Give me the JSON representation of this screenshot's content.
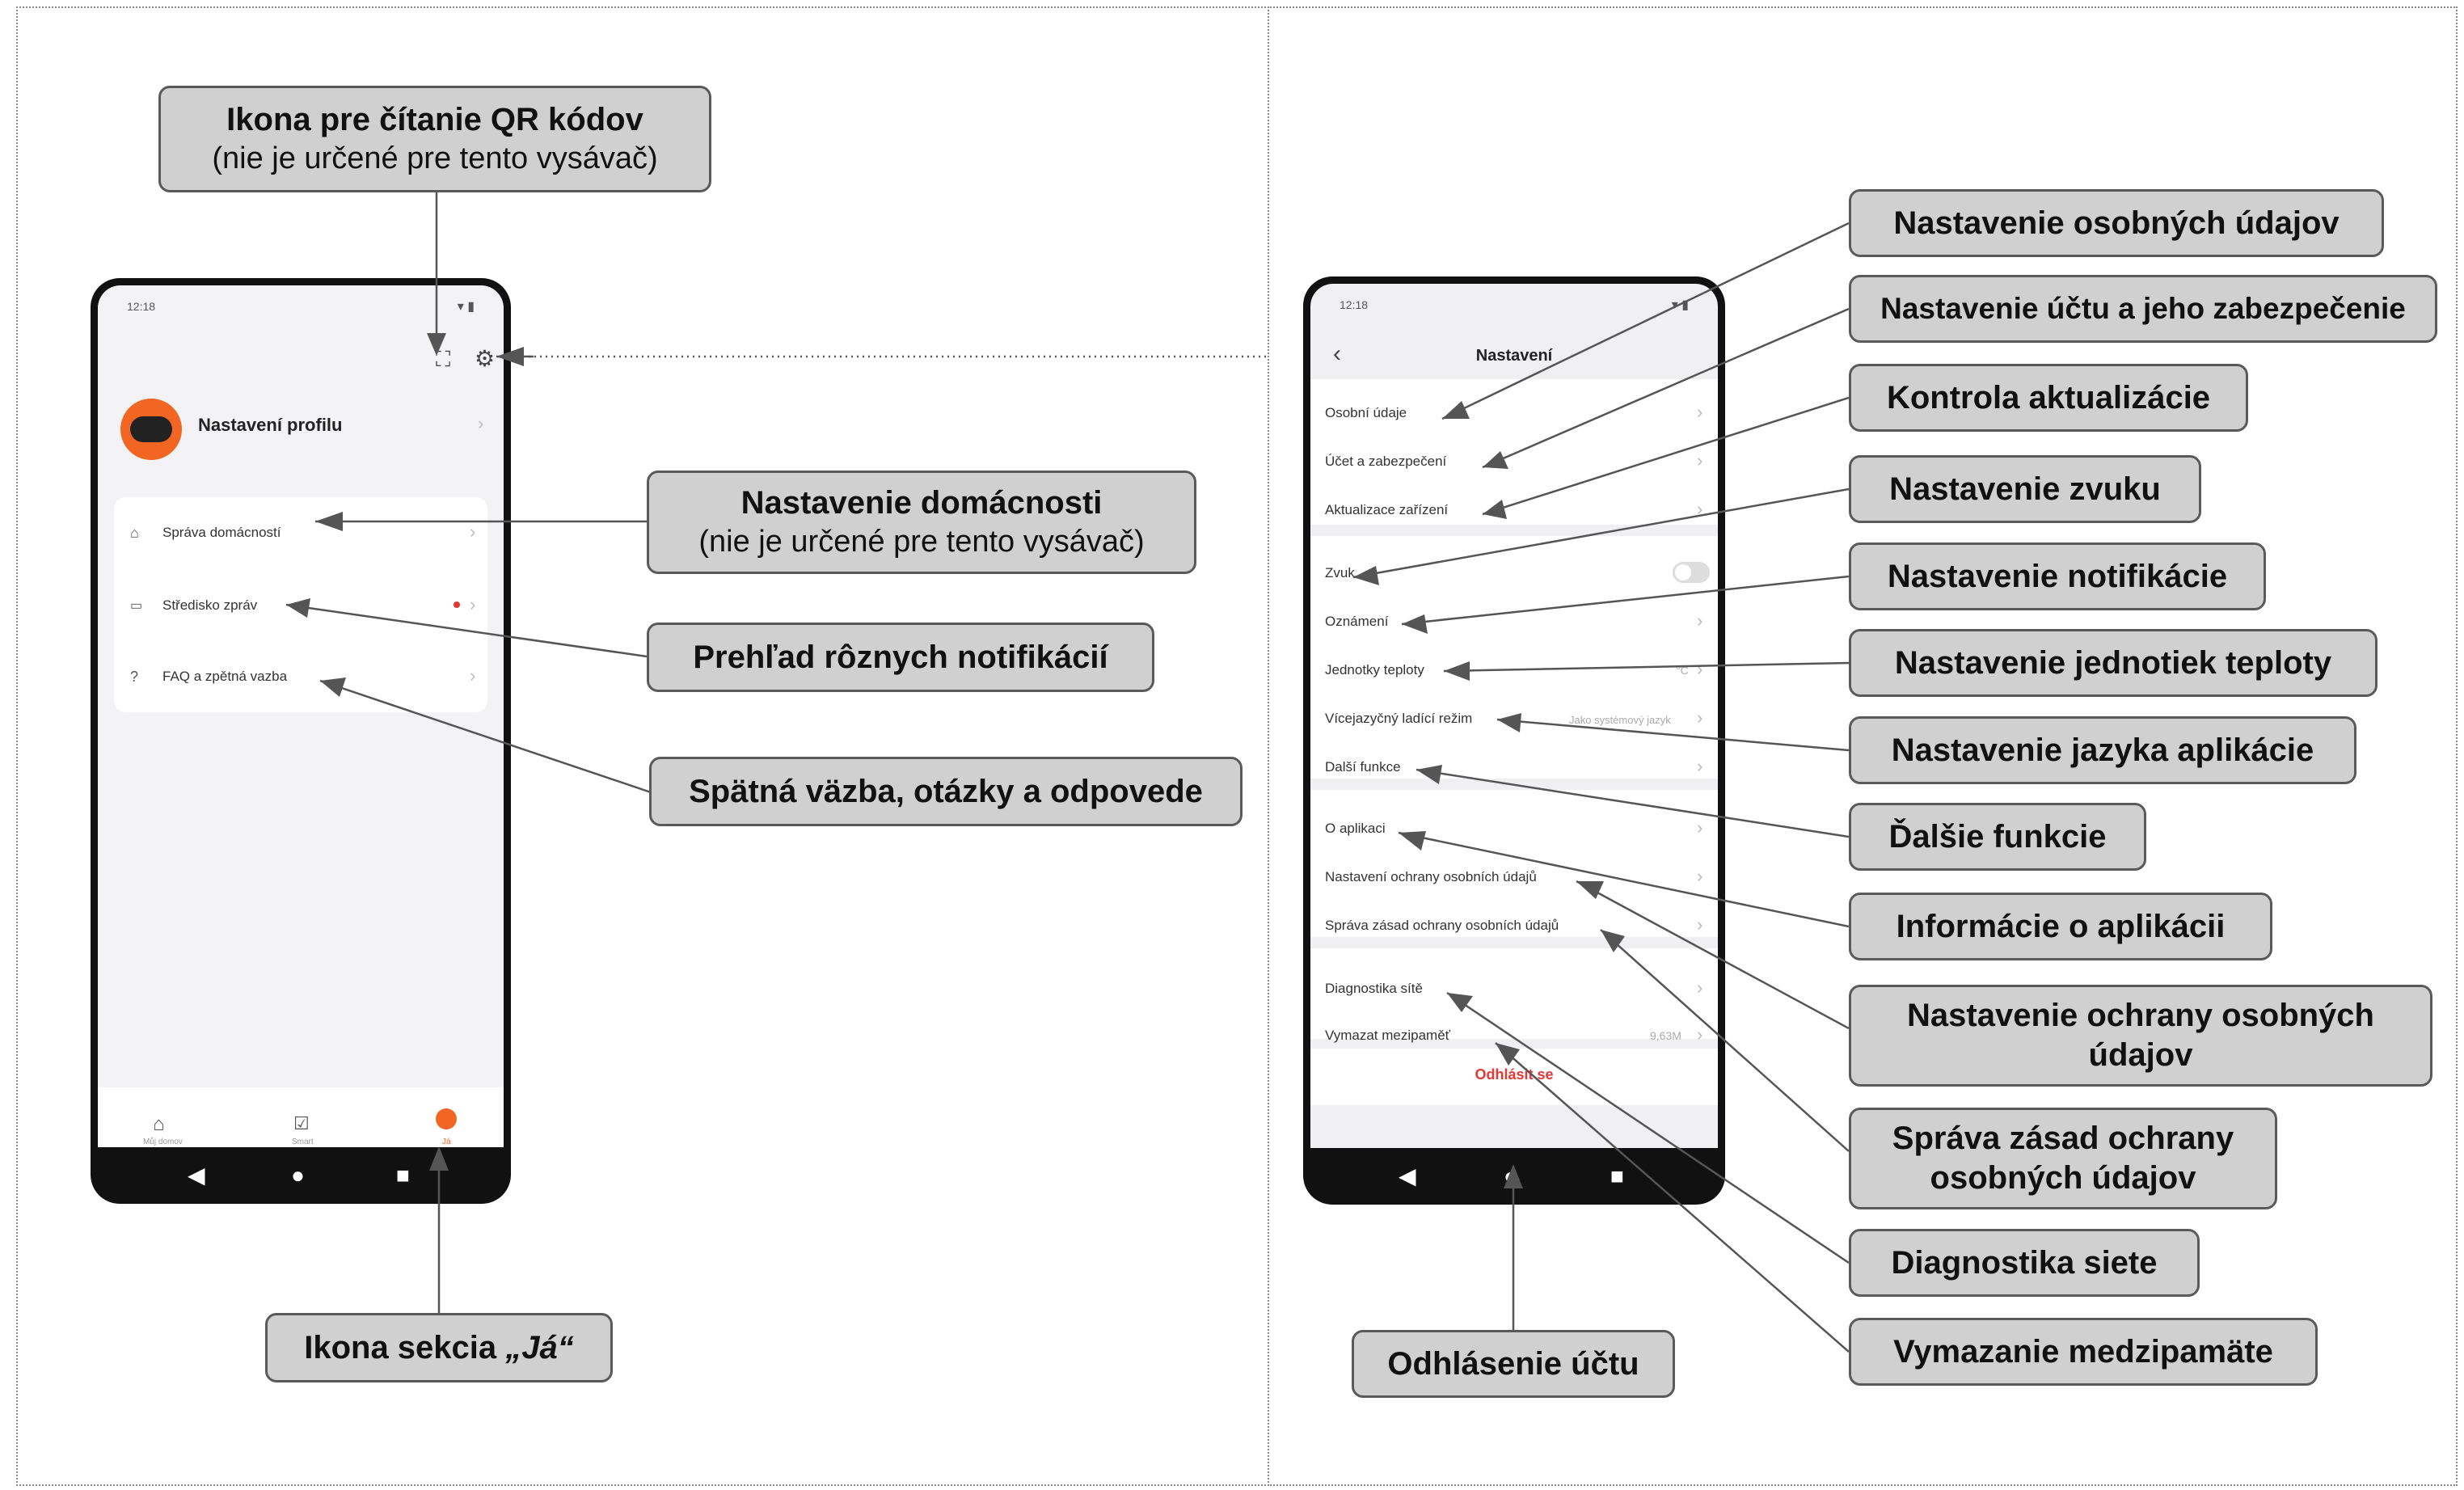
{
  "left_screen": {
    "time": "12:18",
    "profile_label": "Nastavení profilu",
    "menu": [
      "Správa domácností",
      "Středisko zpráv",
      "FAQ a zpětná vazba"
    ],
    "tabs": [
      "Můj domov",
      "Smart",
      "Já"
    ]
  },
  "right_screen": {
    "time": "12:18",
    "title": "Nastavení",
    "group1": [
      "Osobní údaje",
      "Účet a zabezpečení",
      "Aktualizace zařízení"
    ],
    "group2": [
      "Zvuk",
      "Oznámení",
      "Jednotky teploty",
      "Vícejazyčný ladící režim",
      "Další funkce"
    ],
    "temp_unit": "°C",
    "language_value": "Jako systémový jazyk",
    "group3": [
      "O aplikaci",
      "Nastavení ochrany osobních údajů",
      "Správa zásad ochrany osobních údajů"
    ],
    "group4": [
      "Diagnostika sítě",
      "Vymazat mezipaměť"
    ],
    "cache_size": "9,63M",
    "logout": "Odhlásit se"
  },
  "callouts_left": {
    "qr_title": "Ikona pre čítanie QR kódov",
    "qr_sub": "(nie je určené pre tento vysávač)",
    "home_title": "Nastavenie domácnosti",
    "home_sub": "(nie je určené pre tento vysávač)",
    "notif": "Prehľad rôznych notifikácií",
    "faq": "Spätná väzba, otázky a odpovede",
    "me_prefix": "Ikona sekcia ",
    "me_name": "„Já“"
  },
  "callouts_right": [
    "Nastavenie osobných údajov",
    "Nastavenie účtu a jeho zabezpečenie",
    "Kontrola aktualizácie",
    "Nastavenie zvuku",
    "Nastavenie notifikácie",
    "Nastavenie jednotiek teploty",
    "Nastavenie jazyka aplikácie",
    "Ďalšie funkcie",
    "Informácie o aplikácii",
    "Nastavenie ochrany osobných údajov",
    "Správa zásad ochrany osobných údajov",
    "Diagnostika siete",
    "Vymazanie medzipamäte"
  ],
  "logout_callout": "Odhlásenie účtu",
  "colors": {
    "callout_bg": "#d0d0d0",
    "callout_border": "#5a5a5a",
    "accent": "#f26522",
    "logout_red": "#e53935"
  }
}
